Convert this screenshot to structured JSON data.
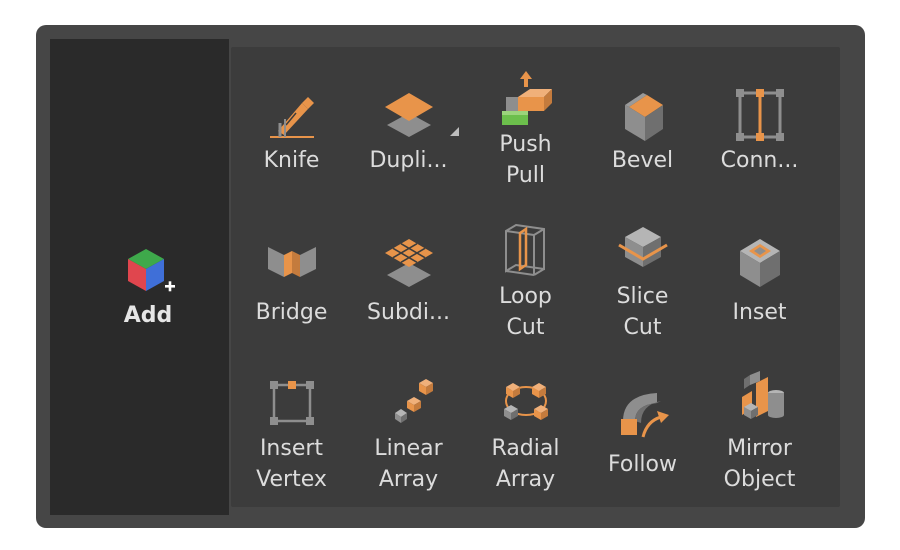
{
  "add": {
    "label": "Add"
  },
  "tools": [
    {
      "id": "knife",
      "lines": [
        "Knife"
      ],
      "icon": "knife-icon"
    },
    {
      "id": "duplicate",
      "lines": [
        "Dupli..."
      ],
      "icon": "duplicate-icon",
      "has_submenu": true
    },
    {
      "id": "push-pull",
      "lines": [
        "Push",
        "Pull"
      ],
      "icon": "push-pull-icon"
    },
    {
      "id": "bevel",
      "lines": [
        "Bevel"
      ],
      "icon": "bevel-icon"
    },
    {
      "id": "connect",
      "lines": [
        "Conn..."
      ],
      "icon": "connect-icon"
    },
    {
      "id": "bridge",
      "lines": [
        "Bridge"
      ],
      "icon": "bridge-icon"
    },
    {
      "id": "subdivide",
      "lines": [
        "Subdi..."
      ],
      "icon": "subdivide-icon"
    },
    {
      "id": "loop-cut",
      "lines": [
        "Loop",
        "Cut"
      ],
      "icon": "loop-cut-icon"
    },
    {
      "id": "slice-cut",
      "lines": [
        "Slice",
        "Cut"
      ],
      "icon": "slice-cut-icon"
    },
    {
      "id": "inset",
      "lines": [
        "Inset"
      ],
      "icon": "inset-icon"
    },
    {
      "id": "insert-vertex",
      "lines": [
        "Insert",
        "Vertex"
      ],
      "icon": "insert-vertex-icon"
    },
    {
      "id": "linear-array",
      "lines": [
        "Linear",
        "Array"
      ],
      "icon": "linear-array-icon"
    },
    {
      "id": "radial-array",
      "lines": [
        "Radial",
        "Array"
      ],
      "icon": "radial-array-icon"
    },
    {
      "id": "follow",
      "lines": [
        "Follow"
      ],
      "icon": "follow-icon"
    },
    {
      "id": "mirror-object",
      "lines": [
        "Mirror",
        "Object"
      ],
      "icon": "mirror-object-icon"
    }
  ],
  "colors": {
    "accent": "#e8944a",
    "grey": "#8e8e8e",
    "grey_light": "#b5b5b5",
    "text": "#dcdcdc",
    "panel": "#464646",
    "tool_bg": "#3c3c3c",
    "add_bg": "#2a2a2a"
  }
}
